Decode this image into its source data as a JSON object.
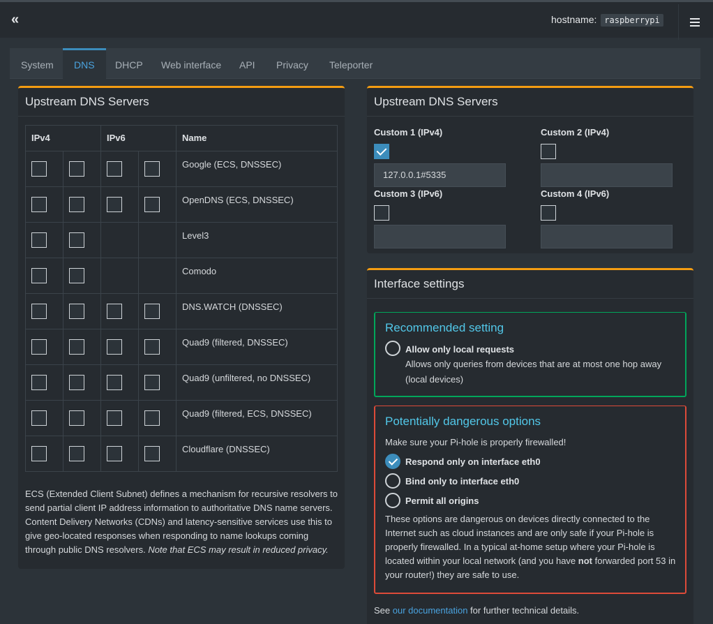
{
  "header": {
    "collapse_icon": "double-chevron-left-icon",
    "hostname_label": "hostname:",
    "hostname_value": "raspberrypi",
    "menu_icon": "hamburger-icon"
  },
  "tabs": [
    {
      "label": "System",
      "active": false
    },
    {
      "label": "DNS",
      "active": true
    },
    {
      "label": "DHCP",
      "active": false
    },
    {
      "label": "Web interface",
      "active": false
    },
    {
      "label": "API",
      "active": false
    },
    {
      "label": "Privacy",
      "active": false
    },
    {
      "label": "Teleporter",
      "active": false
    }
  ],
  "upstream": {
    "title": "Upstream DNS Servers",
    "col_ipv4": "IPv4",
    "col_ipv6": "IPv6",
    "col_name": "Name",
    "rows": [
      {
        "name": "Google (ECS, DNSSEC)"
      },
      {
        "name": "OpenDNS (ECS, DNSSEC)"
      },
      {
        "name": "Level3"
      },
      {
        "name": "Comodo"
      },
      {
        "name": "DNS.WATCH (DNSSEC)"
      },
      {
        "name": "Quad9 (filtered, DNSSEC)"
      },
      {
        "name": "Quad9 (unfiltered, no DNSSEC)"
      },
      {
        "name": "Quad9 (filtered, ECS, DNSSEC)"
      },
      {
        "name": "Cloudflare (DNSSEC)"
      }
    ],
    "note": "ECS (Extended Client Subnet) defines a mechanism for recursive resolvers to send partial client IP address information to authoritative DNS name servers. Content Delivery Networks (CDNs) and latency-sensitive services use this to give geo-located responses when responding to name lookups coming through public DNS resolvers. ",
    "note_italic": "Note that ECS may result in reduced privacy."
  },
  "custom": {
    "title": "Upstream DNS Servers",
    "c1_label": "Custom 1 (IPv4)",
    "c1_value": "127.0.0.1#5335",
    "c2_label": "Custom 2 (IPv4)",
    "c2_value": "",
    "c3_label": "Custom 3 (IPv6)",
    "c3_value": "",
    "c4_label": "Custom 4 (IPv6)",
    "c4_value": ""
  },
  "interface": {
    "title": "Interface settings",
    "recommended_title": "Recommended setting",
    "local_label": "Allow only local requests",
    "local_desc_1": "Allows only queries from devices that are at most one hop away",
    "local_desc_2": "(local devices)",
    "danger_title": "Potentially dangerous options",
    "danger_intro": "Make sure your Pi-hole is properly firewalled!",
    "opt_respond": "Respond only on interface eth0",
    "opt_bind": "Bind only to interface eth0",
    "opt_permit": "Permit all origins",
    "warn_1": "These options are dangerous on devices directly connected to the Internet such as cloud instances and are only safe if your Pi-hole is properly firewalled. In a typical at-home setup where your Pi-hole is located within your local network (and you have ",
    "warn_bold": "not",
    "warn_2": " forwarded port 53 in your router!) they are safe to use.",
    "see_prefix": "See ",
    "see_link": "our documentation",
    "see_suffix": " for further technical details."
  }
}
